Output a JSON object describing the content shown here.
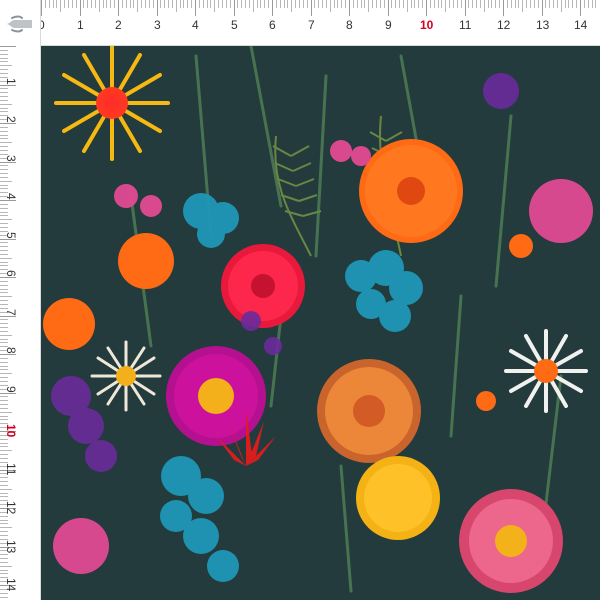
{
  "ruler": {
    "unit": "cm",
    "top_labels": [
      "0",
      "1",
      "2",
      "3",
      "4",
      "5",
      "6",
      "7",
      "8",
      "9",
      "10",
      "11",
      "12",
      "13",
      "14"
    ],
    "left_labels": [
      "1",
      "2",
      "3",
      "4",
      "5",
      "6",
      "7",
      "8",
      "9",
      "10",
      "11",
      "12",
      "13",
      "14"
    ],
    "accent_label": "10",
    "accent_color": "#d3001f"
  },
  "swatch": {
    "background_color": "#233b3d",
    "motif": "embroidered-wildflowers-icon"
  }
}
